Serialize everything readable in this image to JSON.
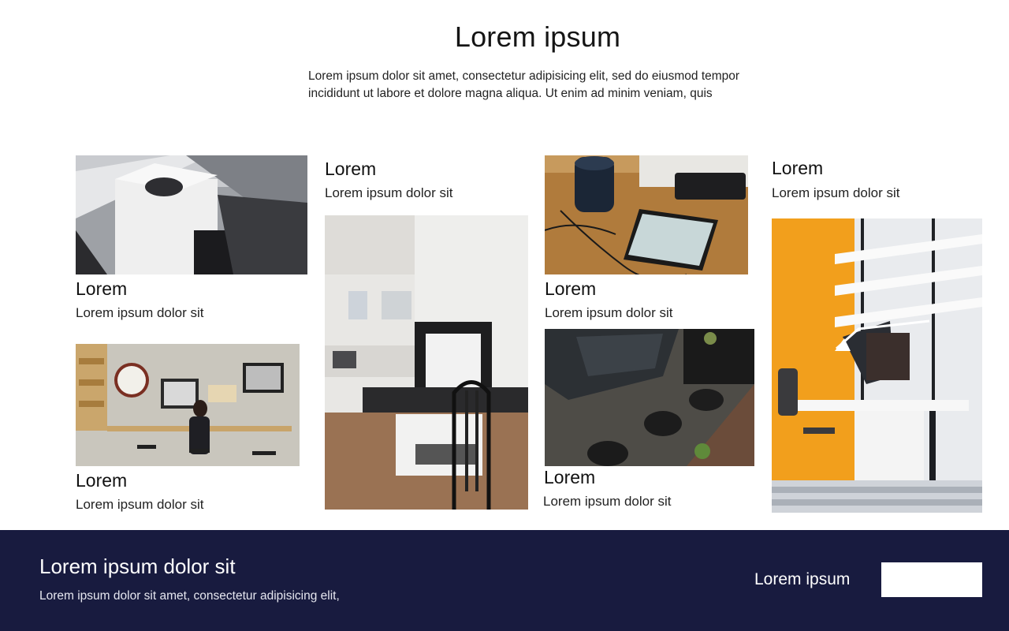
{
  "hero": {
    "title": "Lorem ipsum",
    "description": "Lorem ipsum dolor sit amet, consectetur adipisicing elit, sed do eiusmod tempor incididunt ut labore et dolore magna aliqua. Ut enim ad minim veniam, quis"
  },
  "gallery": {
    "cards": [
      {
        "title": "Lorem",
        "subtitle": "Lorem ipsum dolor sit",
        "image": "laptop-smartwatch-product-photo"
      },
      {
        "title": "Lorem",
        "subtitle": "Lorem ipsum dolor sit",
        "image": "cafe-wall-woman-photo"
      },
      {
        "title": "Lorem",
        "subtitle": "Lorem ipsum dolor sit",
        "image": "living-room-fireplace-photo"
      },
      {
        "title": "Lorem",
        "subtitle": "Lorem ipsum dolor sit",
        "image": "speaker-smartphone-desk-photo"
      },
      {
        "title": "Lorem",
        "subtitle": "Lorem ipsum dolor sit",
        "image": "lounge-chairs-aerial-photo"
      },
      {
        "title": "Lorem",
        "subtitle": "Lorem ipsum dolor sit",
        "image": "orange-wall-desk-photo"
      }
    ]
  },
  "footer": {
    "title": "Lorem ipsum dolor sit",
    "description": "Lorem ipsum dolor sit amet, consectetur adipisicing elit,",
    "link_label": "Lorem ipsum",
    "button_label": ""
  },
  "colors": {
    "footer_background": "#181b3f",
    "accent_orange": "#f2a01e"
  }
}
